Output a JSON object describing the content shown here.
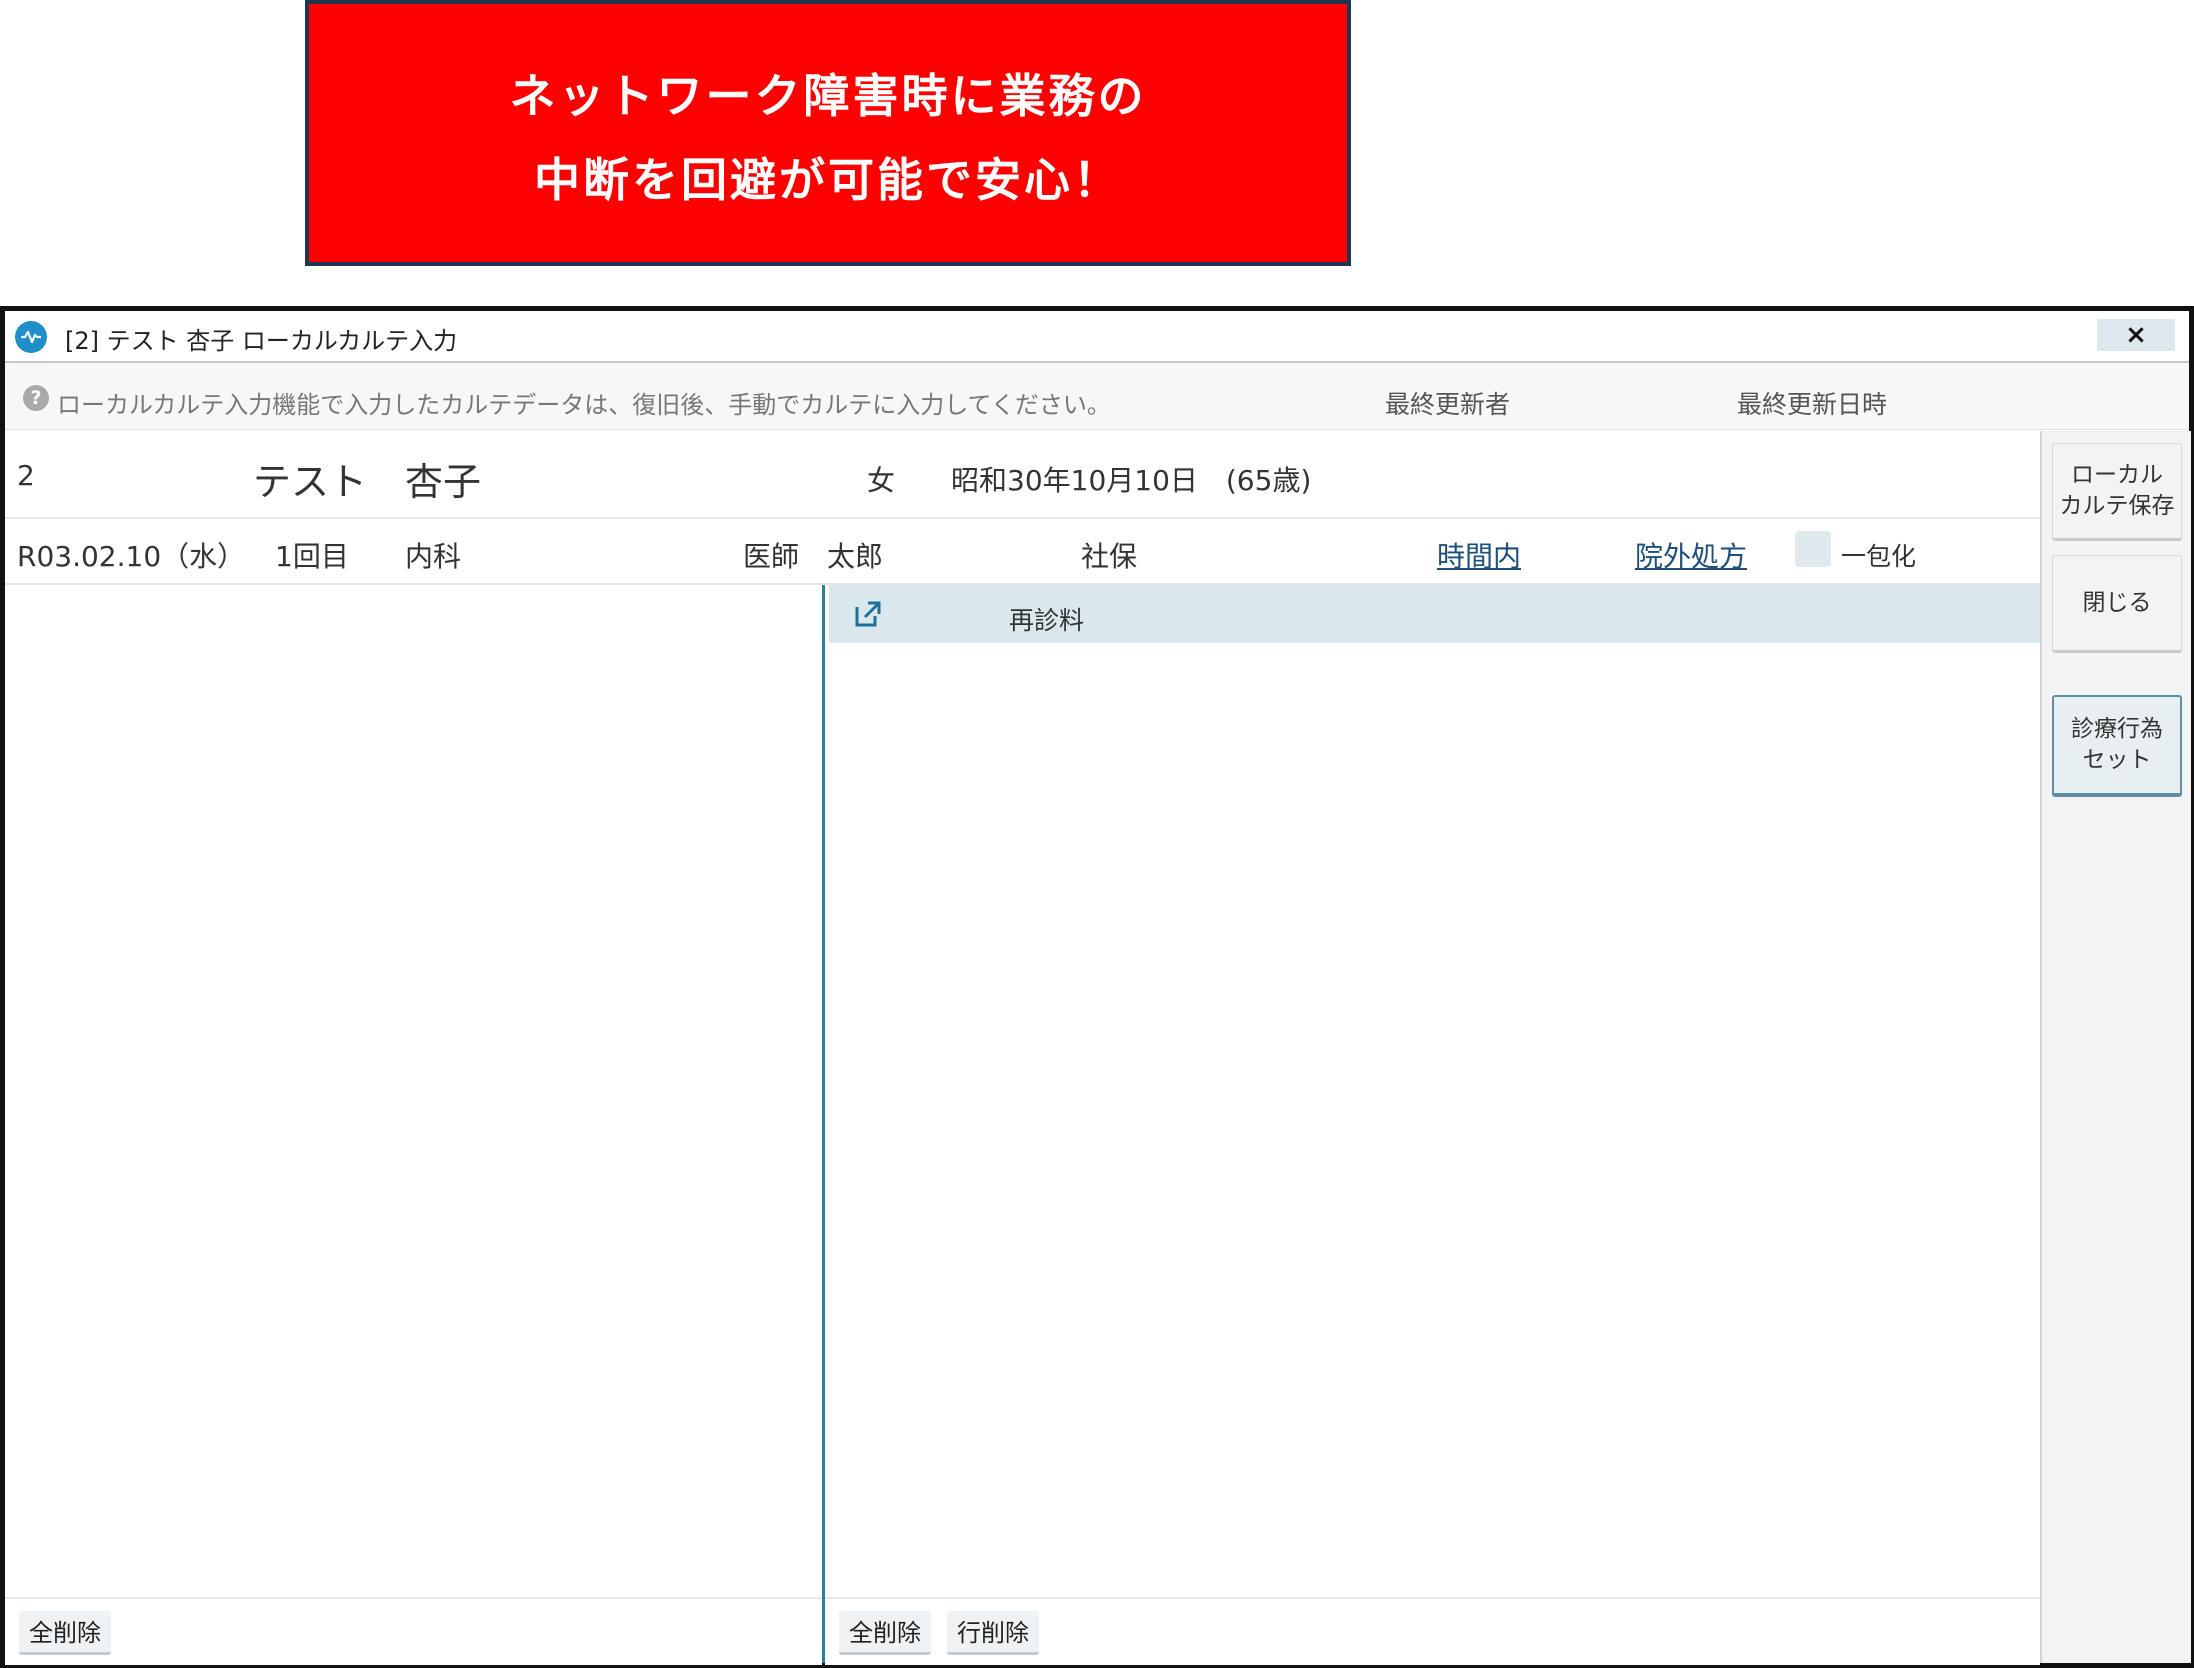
{
  "banner": {
    "line1": "ネットワーク障害時に業務の",
    "line2": "中断を回避が可能で安心！"
  },
  "window": {
    "title": "[2] テスト 杏子 ローカルカルテ入力",
    "close_label": "×",
    "info_message": "ローカルカルテ入力機能で入力したカルテデータは、復旧後、手動でカルテに入力してください。",
    "last_updater_label": "最終更新者",
    "last_updated_label": "最終更新日時"
  },
  "patient": {
    "id": "2",
    "name": "テスト　杏子",
    "sex": "女",
    "birth": "昭和30年10月10日　(65歳)"
  },
  "visit": {
    "date": "R03.02.10（水）",
    "count": "1回目",
    "department": "内科",
    "doctor": "医師　太郎",
    "insurance": "社保",
    "time_link": "時間内",
    "prescription_link": "院外処方",
    "package_label": "一包化"
  },
  "right_panel": {
    "rows": [
      {
        "label": "再診料"
      }
    ]
  },
  "footer": {
    "left_delete_all": "全削除",
    "right_delete_all": "全削除",
    "right_delete_row": "行削除"
  },
  "sidebar": {
    "save_line1": "ローカル",
    "save_line2": "カルテ保存",
    "close": "閉じる",
    "set_line1": "診療行為",
    "set_line2": "セット"
  }
}
